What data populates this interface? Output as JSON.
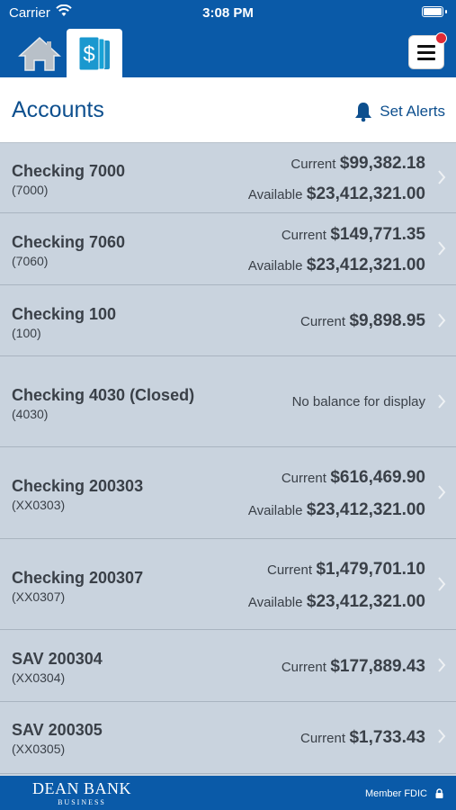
{
  "status_bar": {
    "carrier": "Carrier",
    "time": "3:08 PM"
  },
  "nav": {
    "tabs": [
      {
        "icon": "home-icon"
      },
      {
        "icon": "accounts-dollar-icon",
        "active": true
      }
    ],
    "menu_icon": "hamburger-menu-icon",
    "menu_notification": true
  },
  "header": {
    "title": "Accounts",
    "set_alerts": "Set Alerts",
    "bell_icon": "bell-icon"
  },
  "accounts": [
    {
      "name": "Checking 7000",
      "number": "(7000)",
      "current_label": "Current",
      "current": "$99,382.18",
      "available_label": "Available",
      "available": "$23,412,321.00"
    },
    {
      "name": "Checking 7060",
      "number": "(7060)",
      "current_label": "Current",
      "current": "$149,771.35",
      "available_label": "Available",
      "available": "$23,412,321.00"
    },
    {
      "name": "Checking 100",
      "number": "(100)",
      "current_label": "Current",
      "current": "$9,898.95"
    },
    {
      "name": "Checking 4030 (Closed)",
      "number": "(4030)",
      "no_balance": "No balance for display"
    },
    {
      "name": "Checking 200303",
      "number": "(XX0303)",
      "current_label": "Current",
      "current": "$616,469.90",
      "available_label": "Available",
      "available": "$23,412,321.00"
    },
    {
      "name": "Checking 200307",
      "number": "(XX0307)",
      "current_label": "Current",
      "current": "$1,479,701.10",
      "available_label": "Available",
      "available": "$23,412,321.00"
    },
    {
      "name": "SAV 200304",
      "number": "(XX0304)",
      "current_label": "Current",
      "current": "$177,889.43"
    },
    {
      "name": "SAV 200305",
      "number": "(XX0305)",
      "current_label": "Current",
      "current": "$1,733.43"
    }
  ],
  "footer": {
    "brand": "DEAN BANK",
    "brand_sub": "BUSINESS",
    "fdic": "Member FDIC"
  },
  "colors": {
    "primary": "#0a5aa8",
    "header_text": "#0d4f8e",
    "row_bg": "#c9d3de",
    "badge": "#e02b36"
  }
}
